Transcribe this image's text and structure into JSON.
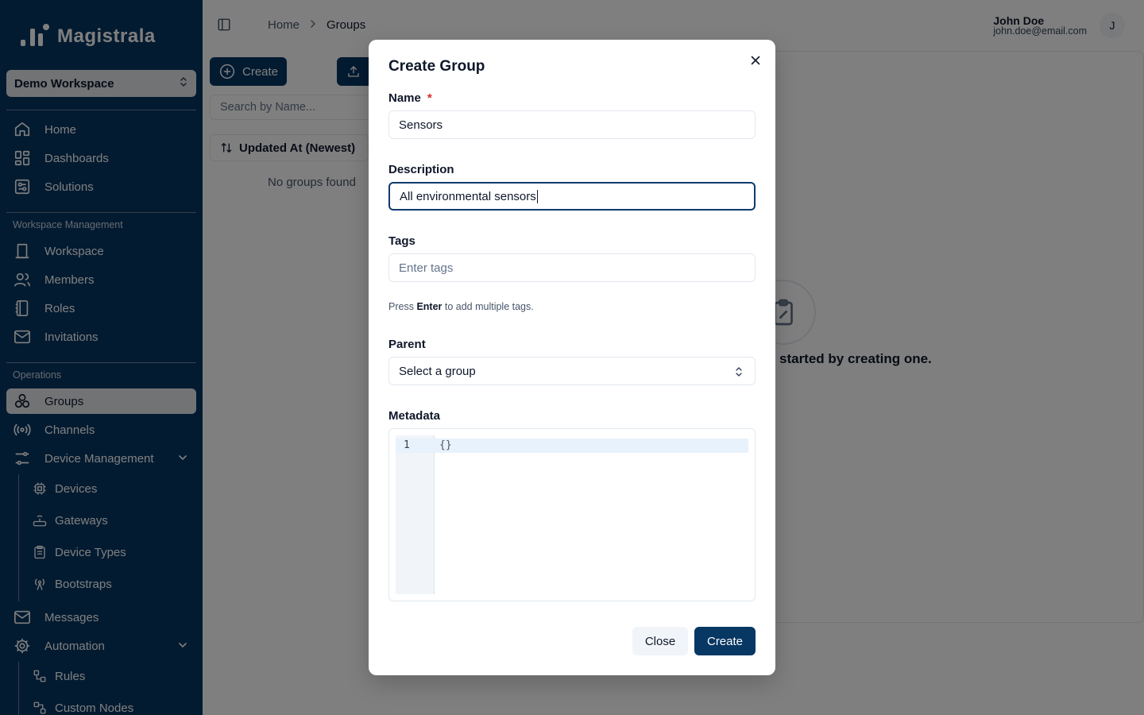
{
  "app": {
    "logo_text": "Magistrala",
    "workspace": "Demo Workspace"
  },
  "sidebar": {
    "main_items": [
      {
        "label": "Home",
        "icon": "home-icon"
      },
      {
        "label": "Dashboards",
        "icon": "dashboard-icon"
      },
      {
        "label": "Solutions",
        "icon": "solutions-icon"
      }
    ],
    "section_workspace": "Workspace Management",
    "workspace_items": [
      {
        "label": "Workspace",
        "icon": "building-icon"
      },
      {
        "label": "Members",
        "icon": "users-icon"
      },
      {
        "label": "Roles",
        "icon": "book-icon"
      },
      {
        "label": "Invitations",
        "icon": "mail-icon"
      }
    ],
    "section_operations": "Operations",
    "groups": "Groups",
    "channels": "Channels",
    "device_management": "Device Management",
    "device_sub": [
      "Devices",
      "Gateways",
      "Device Types",
      "Bootstraps"
    ],
    "messages": "Messages",
    "automation": "Automation",
    "automation_sub": [
      "Rules",
      "Custom Nodes"
    ]
  },
  "header": {
    "breadcrumb_home": "Home",
    "breadcrumb_current": "Groups",
    "user_name": "John Doe",
    "user_email": "john.doe@email.com",
    "avatar_initial": "J"
  },
  "page": {
    "create_button": "Create",
    "search_placeholder": "Search by Name...",
    "sort_label": "Updated At (Newest)",
    "no_groups": "No groups found",
    "empty_text": "started by creating one."
  },
  "dialog": {
    "title": "Create Group",
    "name_label": "Name",
    "required_mark": "*",
    "name_value": "Sensors",
    "description_label": "Description",
    "description_value": "All environmental sensors",
    "tags_label": "Tags",
    "tags_placeholder": "Enter tags",
    "hint_prefix": "Press ",
    "hint_key": "Enter",
    "hint_suffix": " to add multiple tags.",
    "parent_label": "Parent",
    "parent_value": "Select a group",
    "metadata_label": "Metadata",
    "metadata_line_number": "1",
    "metadata_code": "{}",
    "close_button": "Close",
    "create_button": "Create"
  },
  "colors": {
    "sidebar_bg": "#073763",
    "primary": "#073763",
    "required": "#dc2626"
  }
}
